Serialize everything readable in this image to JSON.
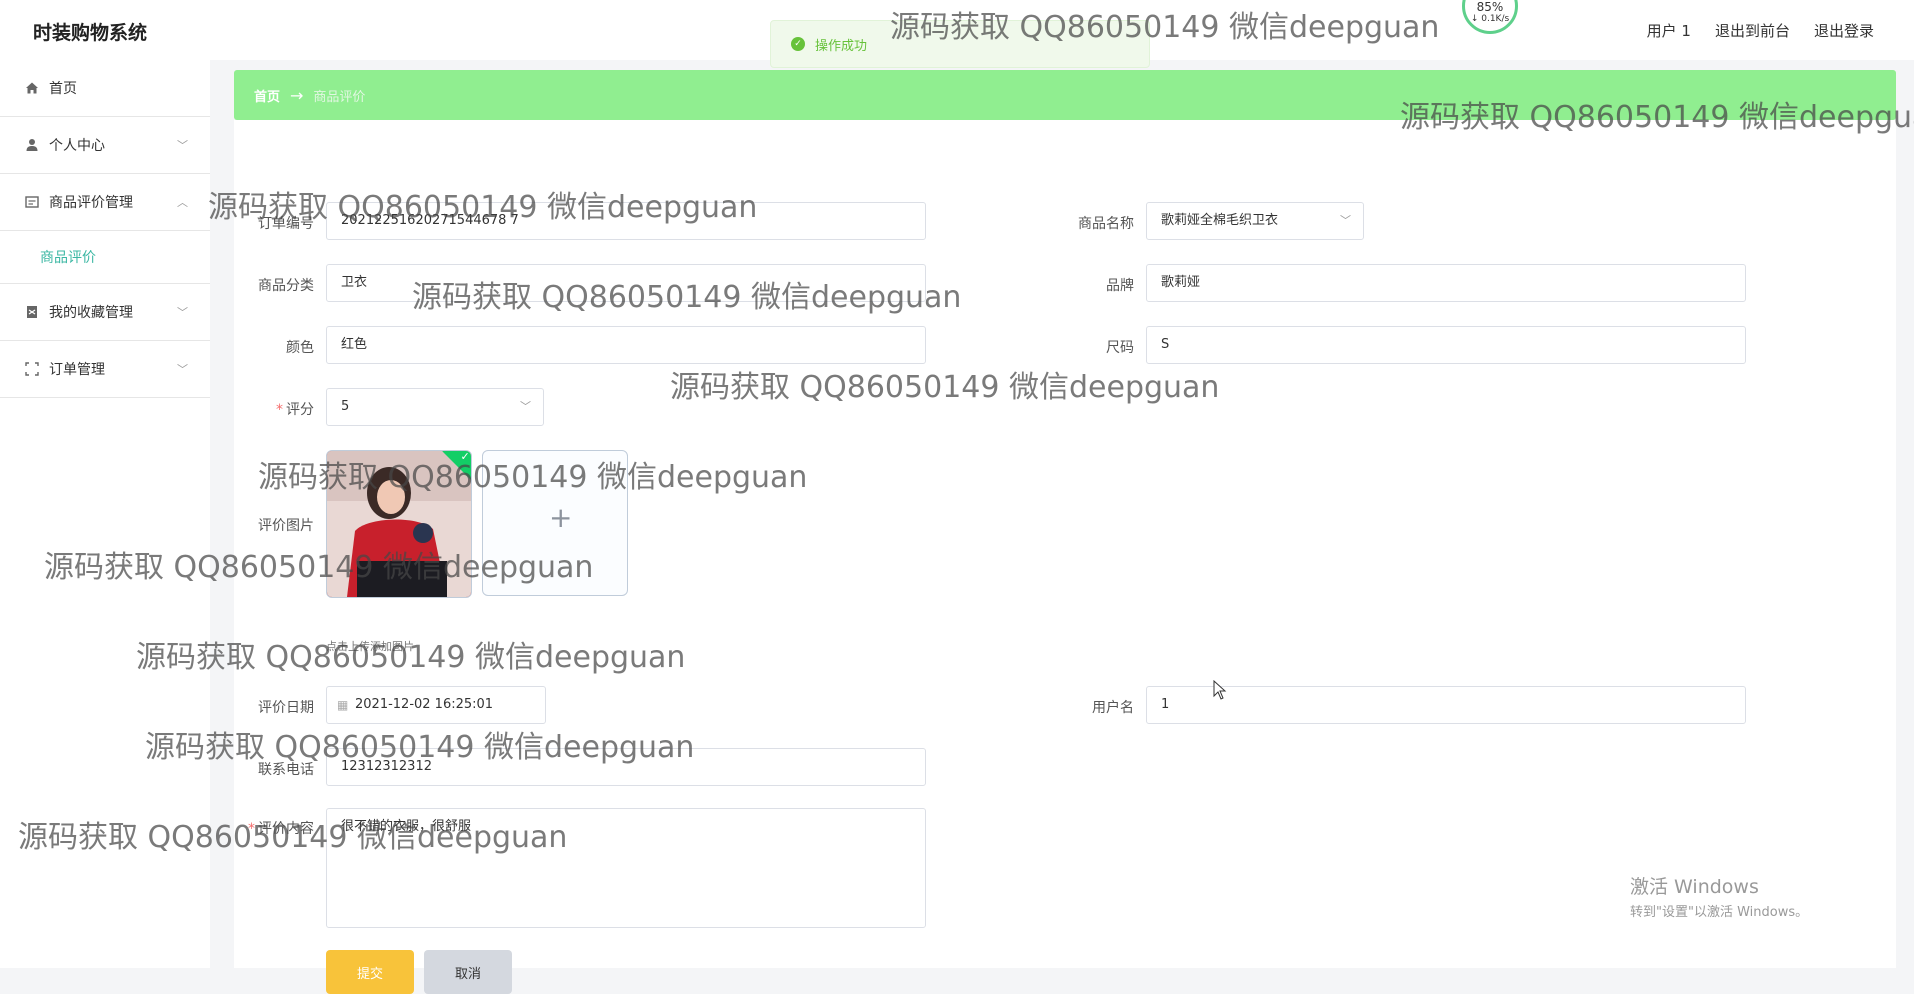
{
  "app": {
    "title": "时装购物系统"
  },
  "header": {
    "links": [
      "用户 1",
      "退出到前台",
      "退出登录"
    ]
  },
  "net_widget": {
    "percent": "85%",
    "speed": "↓ 0.1K/s"
  },
  "toast": {
    "text": "操作成功"
  },
  "sidebar": {
    "items": [
      {
        "label": "首页",
        "icon": "home-icon"
      },
      {
        "label": "个人中心",
        "icon": "user-icon"
      },
      {
        "label": "商品评价管理",
        "icon": "review-icon",
        "expanded": true
      },
      {
        "label": "我的收藏管理",
        "icon": "collect-icon"
      },
      {
        "label": "订单管理",
        "icon": "order-icon"
      }
    ],
    "subitem": {
      "label": "商品评价"
    }
  },
  "breadcrumb": {
    "home": "首页",
    "separator": "→",
    "current": "商品评价"
  },
  "form": {
    "order_no": {
      "label": "订单编号",
      "value": "20212251620271544678 7"
    },
    "product_name": {
      "label": "商品名称",
      "value": "歌莉娅全棉毛织卫衣"
    },
    "category": {
      "label": "商品分类",
      "value": "卫衣"
    },
    "brand": {
      "label": "品牌",
      "value": "歌莉娅"
    },
    "color": {
      "label": "颜色",
      "value": "红色"
    },
    "size": {
      "label": "尺码",
      "value": "S"
    },
    "rating": {
      "label": "评分",
      "value": "5"
    },
    "image": {
      "label": "评价图片",
      "hint": "点击上传添加图片",
      "plus": "+"
    },
    "review_date": {
      "label": "评价日期",
      "value": "2021-12-02 16:25:01"
    },
    "username": {
      "label": "用户名",
      "value": "1"
    },
    "phone": {
      "label": "联系电话",
      "value": "12312312312"
    },
    "content": {
      "label": "评价内容",
      "value": "很不错的衣服，很舒服"
    },
    "submit": "提交",
    "cancel": "取消"
  },
  "watermark": {
    "text": "源码获取 QQ86050149 微信deepguan"
  },
  "os_notice": {
    "line1": "激活 Windows",
    "line2": "转到\"设置\"以激活 Windows。"
  },
  "colors": {
    "breadcrumb_bg": "#90ee90",
    "accent": "#3bb7a3",
    "submit": "#f8c33a",
    "required": "#f56c6c"
  }
}
